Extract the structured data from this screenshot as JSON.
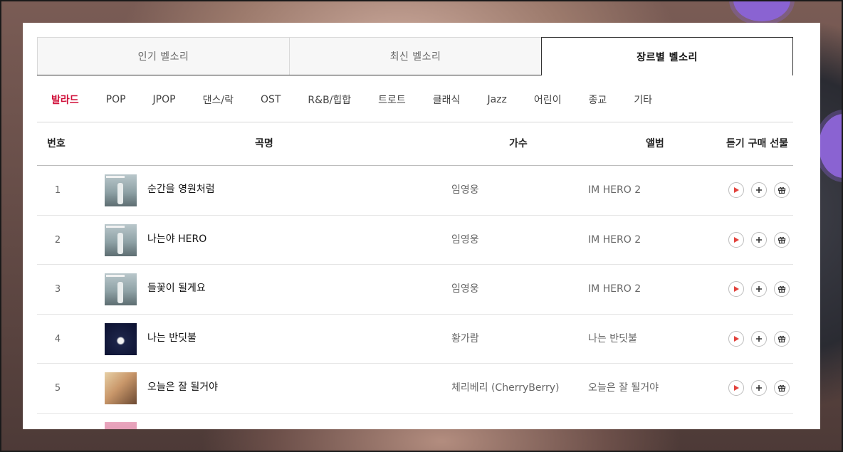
{
  "tabs": [
    {
      "label": "인기 벨소리",
      "active": false
    },
    {
      "label": "최신 벨소리",
      "active": false
    },
    {
      "label": "장르별 벨소리",
      "active": true
    }
  ],
  "genres": [
    "발라드",
    "POP",
    "JPOP",
    "댄스/락",
    "OST",
    "R&B/힙합",
    "트로트",
    "클래식",
    "Jazz",
    "어린이",
    "종교",
    "기타"
  ],
  "active_genre": "발라드",
  "table": {
    "headers": {
      "number": "번호",
      "title": "곡명",
      "artist": "가수",
      "album": "앨범",
      "actions": "듣기 구매 선물"
    },
    "rows": [
      {
        "number": "1",
        "title": "순간을 영원처럼",
        "artist": "임영웅",
        "album": "IM HERO 2"
      },
      {
        "number": "2",
        "title": "나는야 HERO",
        "artist": "임영웅",
        "album": "IM HERO 2"
      },
      {
        "number": "3",
        "title": "들꽃이 될게요",
        "artist": "임영웅",
        "album": "IM HERO 2"
      },
      {
        "number": "4",
        "title": "나는 반딧불",
        "artist": "황가람",
        "album": "나는 반딧불"
      },
      {
        "number": "5",
        "title": "오늘은 잘 될거야",
        "artist": "체리베리 (CherryBerry)",
        "album": "오늘은 잘 될거야"
      },
      {
        "number": "",
        "title": "",
        "artist": "",
        "album": ""
      }
    ]
  },
  "icons": {
    "play": "play-icon",
    "buy": "plus-icon",
    "gift": "gift-icon"
  },
  "colors": {
    "accent": "#d0103a",
    "play": "#e2423c",
    "panel_bg": "#ffffff"
  }
}
